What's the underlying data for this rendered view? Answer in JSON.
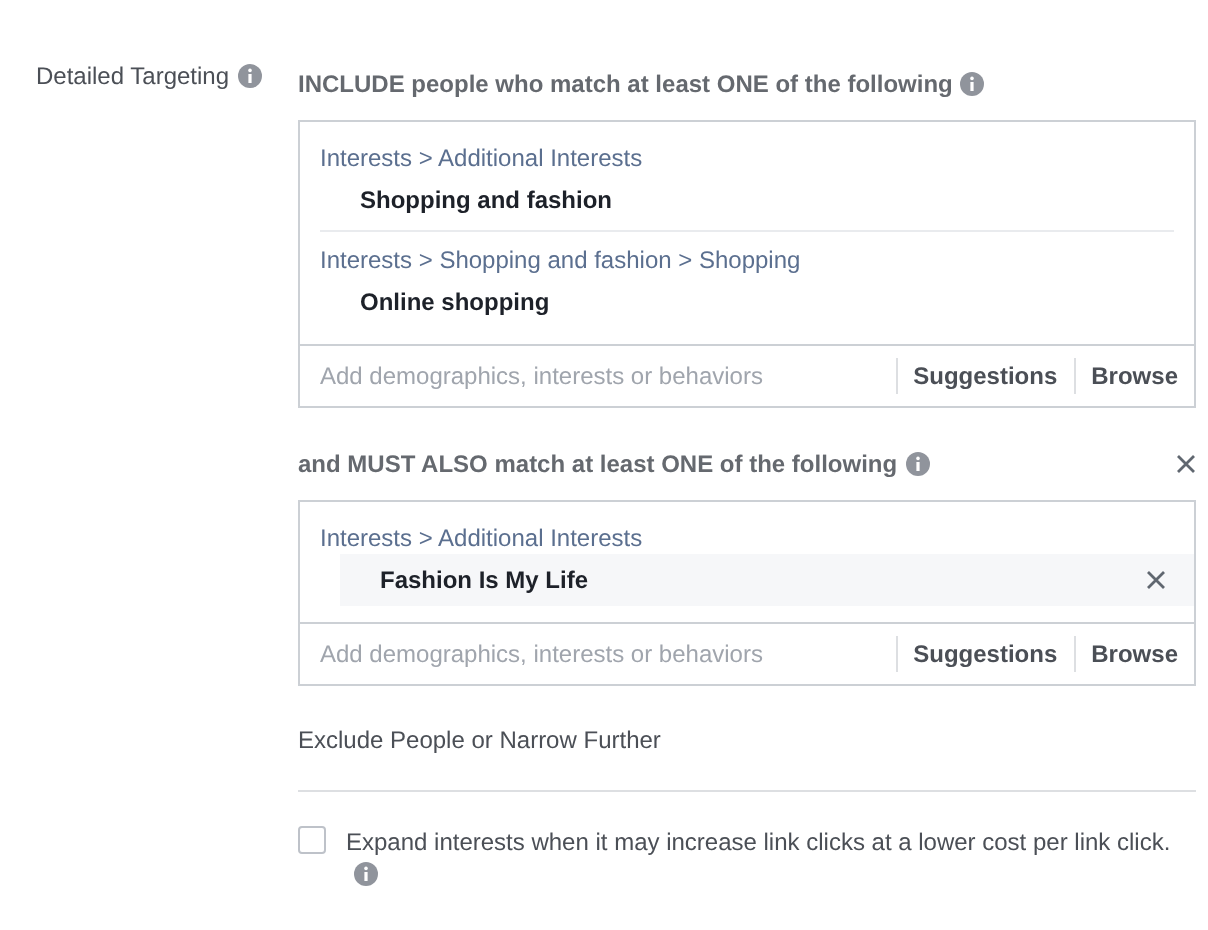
{
  "label": "Detailed Targeting",
  "groups": [
    {
      "heading": "INCLUDE people who match at least ONE of the following",
      "removable": false,
      "entries": [
        {
          "path": "Interests > Additional Interests",
          "item": "Shopping and fashion",
          "highlighted": false
        },
        {
          "path": "Interests > Shopping and fashion > Shopping",
          "item": "Online shopping",
          "highlighted": false
        }
      ],
      "placeholder": "Add demographics, interests or behaviors",
      "actions": [
        "Suggestions",
        "Browse"
      ]
    },
    {
      "heading": "and MUST ALSO match at least ONE of the following",
      "removable": true,
      "entries": [
        {
          "path": "Interests > Additional Interests",
          "item": "Fashion Is My Life",
          "highlighted": true
        }
      ],
      "placeholder": "Add demographics, interests or behaviors",
      "actions": [
        "Suggestions",
        "Browse"
      ]
    }
  ],
  "exclude_link": "Exclude People or Narrow Further",
  "expand": {
    "label": "Expand interests when it may increase link clicks at a lower cost per link click.",
    "checked": false
  }
}
